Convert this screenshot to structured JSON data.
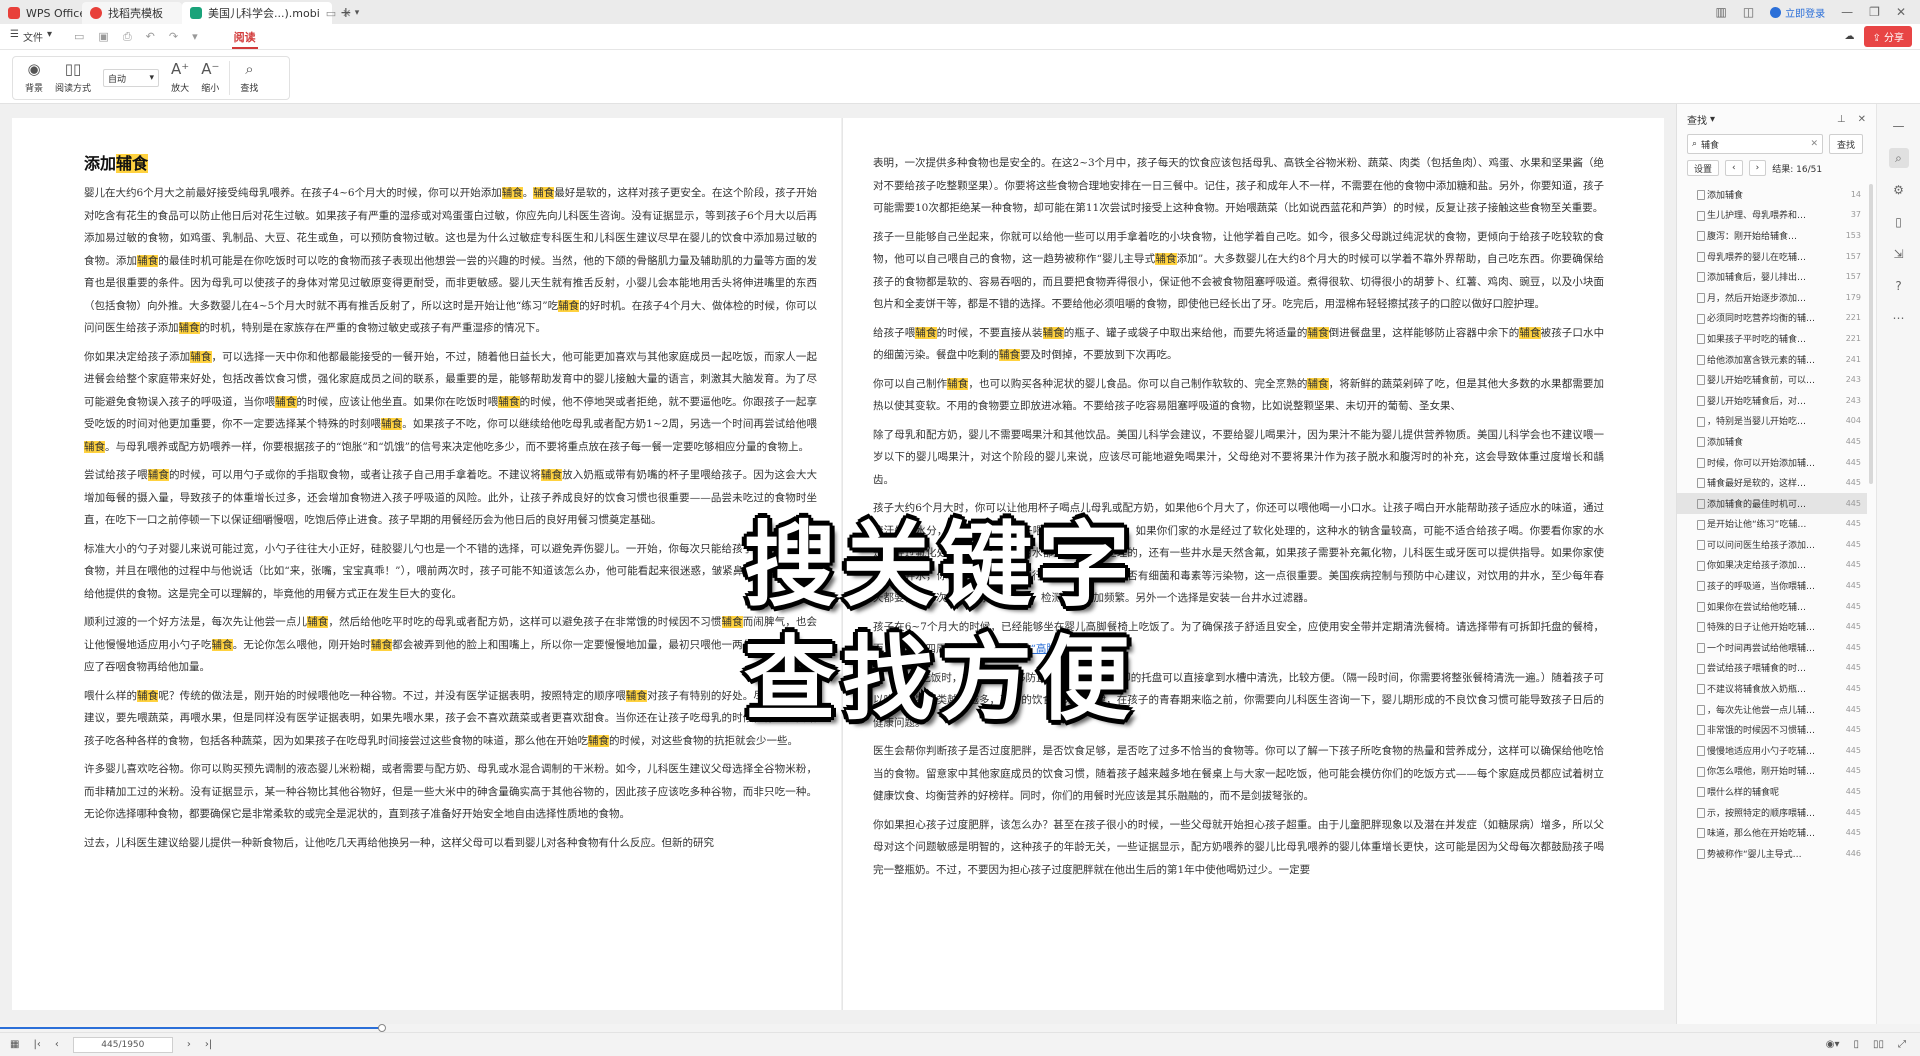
{
  "titlebar": {
    "tabs": [
      {
        "label": "WPS Office",
        "color": "#e8403a"
      },
      {
        "label": "找稻壳模板",
        "color": "#e8403a"
      },
      {
        "label": "美国儿科学会...).mobi",
        "color": "#1aa37a"
      }
    ],
    "login": "立即登录",
    "new_tab": "+"
  },
  "menu": {
    "file": "文件",
    "active_tab": "阅读",
    "share": "分享"
  },
  "toolbar": {
    "background": "背景",
    "read_mode": "阅读方式",
    "zoom_select": "自动",
    "zoom_in": "放大",
    "zoom_out": "缩小",
    "find": "查找"
  },
  "document": {
    "title_prefix": "添加",
    "title_keyword": "辅食",
    "left_paragraphs": [
      "婴儿在大约6个月大之前最好接受纯母乳喂养。在孩子4~6个月大的时候，你可以开始添加辅食。辅食最好是软的，这样对孩子更安全。在这个阶段，孩子开始对吃含有花生的食品可以防止他日后对花生过敏。如果孩子有严重的湿疹或对鸡蛋蛋白过敏，你应先向儿科医生咨询。没有证据显示，等到孩子6个月大以后再添加易过敏的食物，如鸡蛋、乳制品、大豆、花生或鱼，可以预防食物过敏。这也是为什么过敏症专科医生和儿科医生建议尽早在婴儿的饮食中添加易过敏的食物。添加辅食的最佳时机可能是在你吃饭时可以吃的食物而孩子表现出他想尝一尝的兴趣的时候。当然，他的下颌的骨骼肌力量及辅助肌的力量等方面的发育也是很重要的条件。因为母乳可以使孩子的身体对常见过敏原变得更耐受，而非更敏感。婴儿天生就有推舌反射，小婴儿会本能地用舌头将伸进嘴里的东西（包括食物）向外推。大多数婴儿在4~5个月大时就不再有推舌反射了，所以这时是开始让他“练习”吃辅食的好时机。在孩子4个月大、做体检的时候，你可以问问医生给孩子添加辅食的时机，特别是在家族存在严重的食物过敏史或孩子有严重湿疹的情况下。",
      "你如果决定给孩子添加辅食，可以选择一天中你和他都最能接受的一餐开始，不过，随着他日益长大，他可能更加喜欢与其他家庭成员一起吃饭，而家人一起进餐会给整个家庭带来好处，包括改善饮食习惯，强化家庭成员之间的联系，最重要的是，能够帮助发育中的婴儿接触大量的语言，刺激其大脑发育。为了尽可能避免食物误入孩子的呼吸道，当你喂辅食的时候，应该让他坐直。如果你在吃饭时喂辅食的时候，他不停地哭或者拒绝，就不要逼他吃。你跟孩子一起享受吃饭的时间对他更加重要，你不一定要选择某个特殊的时刻喂辅食。如果孩子不吃，你可以继续给他吃母乳或者配方奶1~2周，另选一个时间再尝试给他喂辅食。与母乳喂养或配方奶喂养一样，你要根据孩子的“饱胀”和“饥饿”的信号来决定他吃多少，而不要将重点放在孩子每一餐一定要吃够相应分量的食物上。",
      "尝试给孩子喂辅食的时候，可以用勺子或你的手指取食物，或者让孩子自己用手拿着吃。不建议将辅食放入奶瓶或带有奶嘴的杯子里喂给孩子。因为这会大大增加每餐的摄入量，导致孩子的体重增长过多，还会增加食物进入孩子呼吸道的风险。此外，让孩子养成良好的饮食习惯也很重要——品尝未吃过的食物时坐直，在吃下一口之前停顿一下以保证细嚼慢咽，吃饱后停止进食。孩子早期的用餐经历会为他日后的良好用餐习惯奠定基础。",
      "标准大小的勺子对婴儿来说可能过宽，小勺子往往大小正好，硅胶婴儿勺也是一个不错的选择，可以避免弄伤婴儿。一开始，你每次只能给孩子较少或极少的食物，并且在喂他的过程中与他说话（比如“来，张嘴，宝宝真乖！”），喂前两次时，孩子可能不知道该怎么办，他可能看起来很迷惑，皱紧鼻子，完全拒绝你给他提供的食物。这是完全可以理解的，毕竟他的用餐方式正在发生巨大的变化。",
      "顺利过渡的一个好方法是，每次先让他尝一点儿辅食，然后给他吃平时吃的母乳或者配方奶，这样可以避免孩子在非常饿的时候因不习惯辅食而闹脾气，也会让他慢慢地适应用小勺子吃辅食。无论你怎么喂他，刚开始时辅食都会被弄到他的脸上和围嘴上，所以你一定要慢慢地加量，最初只喂他一两勺，等他完全适应了吞咽食物再给他加量。",
      "喂什么样的辅食呢？传统的做法是，刚开始的时候喂他吃一种谷物。不过，并没有医学证据表明，按照特定的顺序喂辅食对孩子有特别的好处。尽管很多医生建议，要先喂蔬菜，再喂水果，但是同样没有医学证据表明，如果先喂水果，孩子会不喜欢蔬菜或者更喜欢甜食。当你还在让孩子吃母乳的时候，你一定要给孩子吃各种各样的食物，包括各种蔬菜，因为如果孩子在吃母乳时间接尝过这些食物的味道，那么他在开始吃辅食的时候，对这些食物的抗拒就会少一些。",
      "许多婴儿喜欢吃谷物。你可以购买预先调制的液态婴儿米粉糊，或者需要与配方奶、母乳或水混合调制的干米粉。如今，儿科医生建议父母选择全谷物米粉，而非精加工过的米粉。没有证据显示，某一种谷物比其他谷物好，但是一些大米中的砷含量确实高于其他谷物的，因此孩子应该吃多种谷物，而非只吃一种。无论你选择哪种食物，都要确保它是非常柔软的或完全是泥状的，直到孩子准备好开始安全地自由选择性质地的食物。",
      "过去，儿科医生建议给婴儿提供一种新食物后，让他吃几天再给他换另一种，这样父母可以看到婴儿对各种食物有什么反应。但新的研究"
    ],
    "right_paragraphs": [
      "表明，一次提供多种食物也是安全的。在这2~3个月中，孩子每天的饮食应该包括母乳、高铁全谷物米粉、蔬菜、肉类（包括鱼肉）、鸡蛋、水果和坚果酱（绝对不要给孩子吃整颗坚果）。你要将这些食物合理地安排在一日三餐中。记住，孩子和成年人不一样，不需要在他的食物中添加糖和盐。另外，你要知道，孩子可能需要10次都拒绝某一种食物，却可能在第11次尝试时接受上这种食物。开始喂蔬菜（比如说西蓝花和芦笋）的时候，反复让孩子接触这些食物至关重要。",
      "孩子一旦能够自己坐起来，你就可以给他一些可以用手拿着吃的小块食物，让他学着自己吃。如今，很多父母跳过纯泥状的食物，更倾向于给孩子吃较软的食物，他可以自己喂自己的食物，这一趋势被称作“婴儿主导式辅食添加”。大多数婴儿在大约8个月大的时候可以学着不靠外界帮助，自己吃东西。你要确保给孩子的食物都是软的、容易吞咽的，而且要把食物弄得很小，保证他不会被食物阻塞呼吸道。煮得很软、切得很小的胡萝卜、红薯、鸡肉、豌豆，以及小块面包片和全麦饼干等，都是不错的选择。不要给他必须咀嚼的食物，即使他已经长出了牙。吃完后，用湿棉布轻轻擦拭孩子的口腔以做好口腔护理。",
      "给孩子喂辅食的时候，不要直接从装辅食的瓶子、罐子或袋子中取出来给他，而要先将适量的辅食倒进餐盘里，这样能够防止容器中余下的辅食被孩子口水中的细菌污染。餐盘中吃剩的辅食要及时倒掉，不要放到下次再吃。",
      "你可以自己制作辅食，也可以购买各种泥状的婴儿食品。你可以自己制作软软的、完全烹熟的辅食，将新鲜的蔬菜剁碎了吃，但是其他大多数的水果都需要加热以使其变软。不用的食物要立即放进冰箱。不要给孩子吃容易阻塞呼吸道的食物，比如说整颗坚果、未切开的葡萄、圣女果、",
      "除了母乳和配方奶，婴儿不需要喝果汁和其他饮品。美国儿科学会建议，不要给婴儿喝果汁，因为果汁不能为婴儿提供营养物质。美国儿科学会也不建议喂一岁以下的婴儿喝果汁，对这个阶段的婴儿来说，应该尽可能地避免喝果汁，父母绝对不要将果汁作为孩子脱水和腹泻时的补充，这会导致体重过度增长和龋齿。",
      "孩子大约6个月大时，你可以让他用杯子喝点儿母乳或配方奶，如果他6个月大了，你还可以喂他喝一小口水。让孩子喝白开水能帮助孩子适应水的味道，通过流汗失去水分，你可以每天给孩子喂水2次或者更多次。如果你们家的水是经过了软化处理的，这种水的钠含量较高，可能不适合给孩子喝。你要看你家的水是否经过氟化处理。大多数城市用水都是经过氟化处理的，还有一些井水是天然含氟，如果孩子需要补充氟化物，儿科医生或牙医可以提供指导。如果你家使用的是井水，你就要定期对井水进行检测，检查水中是否有细菌和毒素等污染物，这一点很重要。美国疾病控制与预防中心建议，对饮用的井水，至少每年春天都要检测一次，如果存在污染物，检测就要更加频繁。另外一个选择是安装一台井水过滤器。",
      "孩子在6~7个月大的时候，已经能够坐在婴儿高脚餐椅上吃饭了。为了确保孩子舒适且安全，应使用安全带并定期清洗餐椅。请选择带有可拆卸托盘的餐椅，而且托盘的四周要有较高的边（见",
      "），当孩子吃饭时，托盘的边能够防止食物掉落。可拆卸的托盘可以直接拿到水槽中清洗，比较方便。（隔一段时间，你需要将整张餐椅清洗一遍。）随着孩子可以吃的食物种类越来越多，孩子的饮食越来越规律，在孩子的青春期来临之前，你需要向儿科医生咨询一下，婴儿期形成的不良饮食习惯可能导致孩子日后的健康问题。",
      "医生会帮你判断孩子是否过度肥胖，是否饮食足够，是否吃了过多不恰当的食物等。你可以了解一下孩子所吃食物的热量和营养成分，这样可以确保给他吃恰当的食物。留意家中其他家庭成员的饮食习惯，随着孩子越来越多地在餐桌上与大家一起吃饭，他可能会模仿你们的吃饭方式——每个家庭成员都应试着树立健康饮食、均衡营养的好榜样。同时，你们的用餐时光应该是其乐融融的，而不是剑拔弩张的。",
      "你如果担心孩子过度肥胖，该怎么办？甚至在孩子很小的时候，一些父母就开始担心孩子超重。由于儿童肥胖现象以及潜在并发症（如糖尿病）增多，所以父母对这个问题敏感是明智的，这种孩子的年龄无关，一些证据显示，配方奶喂养的婴儿比母乳喂养的婴儿体重增长更快，这可能是因为父母每次都鼓励孩子喝完一整瓶奶。不过，不要因为担心孩子过度肥胖就在他出生后的第1年中使他喝奶过少。一定要"
    ],
    "link_text": "“高脚餐椅”"
  },
  "overlay": {
    "line1": "搜关键字",
    "line2": "查找方便"
  },
  "search_panel": {
    "title": "查找",
    "query": "辅食",
    "find_btn": "查找",
    "settings_btn": "设置",
    "result_label": "结果: 16/51",
    "results": [
      {
        "text": "添加辅食",
        "page": "14"
      },
      {
        "text": "生儿护理、母乳喂养和…",
        "page": "37"
      },
      {
        "text": "腹泻：刚开始给辅食…",
        "page": "153"
      },
      {
        "text": "母乳喂养的婴儿在吃辅…",
        "page": "157"
      },
      {
        "text": "添加辅食后，婴儿排出…",
        "page": "157"
      },
      {
        "text": "月，然后开始逐步添加…",
        "page": "179"
      },
      {
        "text": "必须同时吃营养均衡的辅…",
        "page": "221"
      },
      {
        "text": "如果孩子平时吃的辅食…",
        "page": "221"
      },
      {
        "text": "给他添加富含铁元素的辅…",
        "page": "241"
      },
      {
        "text": "婴儿开始吃辅食前，可以…",
        "page": "243"
      },
      {
        "text": "婴儿开始吃辅食后，对…",
        "page": "243"
      },
      {
        "text": "，特别是当婴儿开始吃…",
        "page": "404"
      },
      {
        "text": "添加辅食",
        "page": "445"
      },
      {
        "text": "时候，你可以开始添加辅…",
        "page": "445"
      },
      {
        "text": "辅食最好是软的，这样…",
        "page": "445"
      },
      {
        "text": "添加辅食的最佳时机可…",
        "page": "445"
      },
      {
        "text": "是开始让他“练习”吃辅…",
        "page": "445"
      },
      {
        "text": "可以问问医生给孩子添加…",
        "page": "445"
      },
      {
        "text": "你如果决定给孩子添加…",
        "page": "445"
      },
      {
        "text": "孩子的呼吸道，当你喂辅…",
        "page": "445"
      },
      {
        "text": "如果你在尝试给他吃辅…",
        "page": "445"
      },
      {
        "text": "特殊的日子让他开始吃辅…",
        "page": "445"
      },
      {
        "text": "一个时间再尝试给他喂辅…",
        "page": "445"
      },
      {
        "text": "尝试给孩子喂辅食的时…",
        "page": "445"
      },
      {
        "text": "不建议将辅食放入奶瓶…",
        "page": "445"
      },
      {
        "text": "，每次先让他尝一点儿辅…",
        "page": "445"
      },
      {
        "text": "非常饿的时候因不习惯辅…",
        "page": "445"
      },
      {
        "text": "慢慢地适应用小勺子吃辅…",
        "page": "445"
      },
      {
        "text": "你怎么喂他，刚开始时辅…",
        "page": "445"
      },
      {
        "text": "喂什么样的辅食呢",
        "page": "445"
      },
      {
        "text": "示，按照特定的顺序喂辅…",
        "page": "445"
      },
      {
        "text": "味道，那么他在开始吃辅…",
        "page": "445"
      },
      {
        "text": "势被称作“婴儿主导式…",
        "page": "446"
      }
    ]
  },
  "statusbar": {
    "page_indicator": "445/1950",
    "progress": 0.228
  },
  "colors": {
    "accent": "#d23a3a",
    "highlight": "#ffd23f",
    "link": "#2b6fd8"
  }
}
